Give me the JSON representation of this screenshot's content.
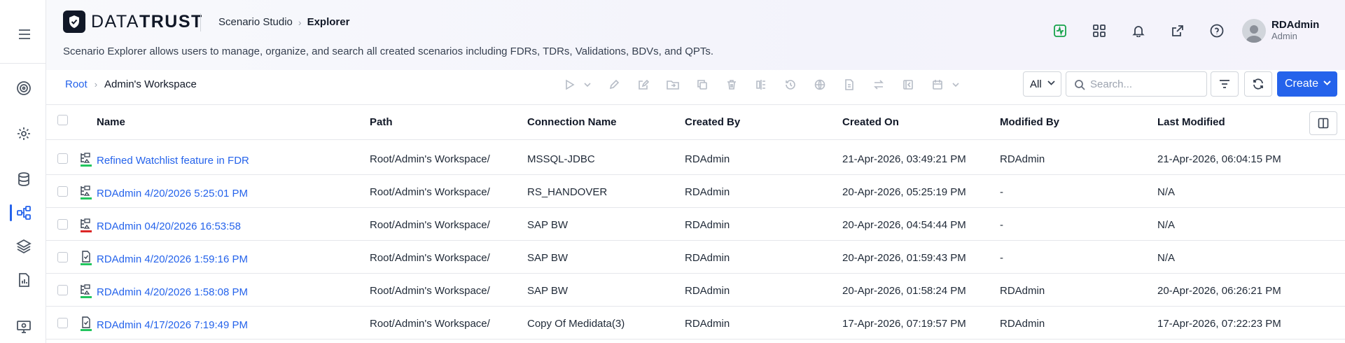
{
  "app": {
    "logo_light": "DATA",
    "logo_bold": "TRUST",
    "nav_parent": "Scenario Studio",
    "nav_current": "Explorer",
    "description": "Scenario Explorer allows users to manage, organize, and search all created scenarios including FDRs, TDRs, Validations, BDVs, and QPTs."
  },
  "user": {
    "name": "RDAdmin",
    "role": "Admin"
  },
  "breadcrumb": {
    "root": "Root",
    "current": "Admin's Workspace"
  },
  "toolbar": {
    "filter_value": "All",
    "search_placeholder": "Search...",
    "create_label": "Create"
  },
  "table": {
    "headers": [
      "Name",
      "Path",
      "Connection Name",
      "Created By",
      "Created On",
      "Modified By",
      "Last Modified"
    ],
    "rows": [
      [
        "Refined Watchlist feature in FDR",
        "Root/Admin's Workspace/",
        "MSSQL-JDBC",
        "RDAdmin",
        "21-Apr-2026, 03:49:21 PM",
        "RDAdmin",
        "21-Apr-2026, 06:04:15 PM"
      ],
      [
        "RDAdmin 4/20/2026 5:25:01 PM",
        "Root/Admin's Workspace/",
        "RS_HANDOVER",
        "RDAdmin",
        "20-Apr-2026, 05:25:19 PM",
        "-",
        "N/A"
      ],
      [
        "RDAdmin 04/20/2026 16:53:58",
        "Root/Admin's Workspace/",
        "SAP BW",
        "RDAdmin",
        "20-Apr-2026, 04:54:44 PM",
        "-",
        "N/A"
      ],
      [
        "RDAdmin 4/20/2026 1:59:16 PM",
        "Root/Admin's Workspace/",
        "SAP BW",
        "RDAdmin",
        "20-Apr-2026, 01:59:43 PM",
        "-",
        "N/A"
      ],
      [
        "RDAdmin 4/20/2026 1:58:08 PM",
        "Root/Admin's Workspace/",
        "SAP BW",
        "RDAdmin",
        "20-Apr-2026, 01:58:24 PM",
        "RDAdmin",
        "20-Apr-2026, 06:26:21 PM"
      ],
      [
        "RDAdmin 4/17/2026 7:19:49 PM",
        "Root/Admin's Workspace/",
        "Copy Of Medidata(3)",
        "RDAdmin",
        "17-Apr-2026, 07:19:57 PM",
        "RDAdmin",
        "17-Apr-2026, 07:22:23 PM"
      ]
    ],
    "row_icons": [
      "fdr-icon",
      "fdr-icon",
      "fdr-error-icon",
      "validation-icon",
      "fdr-icon",
      "validation-icon"
    ]
  },
  "colors": {
    "accent": "#2563eb",
    "success": "#22c55e",
    "error": "#dc2626"
  }
}
